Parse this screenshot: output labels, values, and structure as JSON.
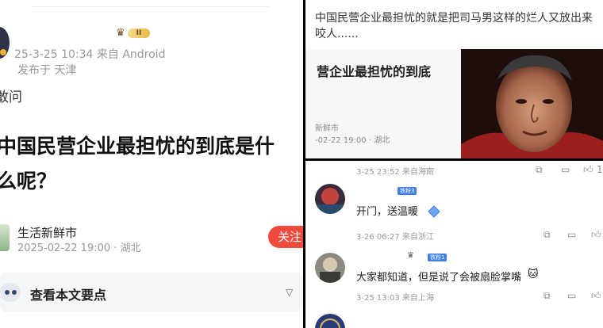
{
  "post": {
    "time_source": "25-3-25 10:34  来自 Android",
    "location": "发布于 天津",
    "level_badge": "II",
    "prefix": "敢问",
    "title_line1": "中国民营企业最担忧的到底是什",
    "title_line2": "么呢？",
    "source_name": "生活新鲜市",
    "source_meta": "2025-02-22 19:00 · 湖北",
    "follow_label": "关注",
    "keypoints_label": "查看本文要点"
  },
  "repost": {
    "text_line1": "中国民营企业最担忧的就是把司马男这样的烂人又放出来",
    "text_line2": "咬人......",
    "card_title": "营企业最担忧的到底",
    "card_source": "新鲜市",
    "card_meta": "-02-22 19:00 · 湖北"
  },
  "comments": {
    "c0_meta": "3-25 23:52  来自海南",
    "c1_badge": "铁粉3",
    "c1_text": "开门，送温暖",
    "c1_meta": "3-26 06:27  来自浙江",
    "c2_badge": "铁粉1",
    "c2_text": "大家都知道，但是说了会被扇脸掌嘴",
    "c2_meta": "3-25 13:03  来自上海",
    "like_count": "1"
  },
  "icons": [
    "crown-icon",
    "robot-icon",
    "chevron-down-icon",
    "share-icon",
    "comment-icon",
    "like-icon",
    "diamond-sticker-icon",
    "cat-emoji-icon"
  ],
  "colors": {
    "follow": "#f04a3c",
    "fans_badge": "#3e7ee8",
    "blue_link": "#3b6bd6"
  }
}
